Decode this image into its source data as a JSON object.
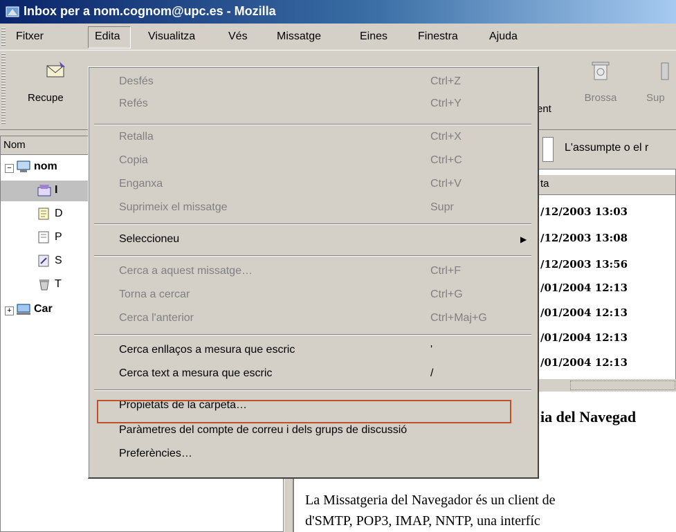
{
  "window": {
    "title": "Inbox per a nom.cognom@upc.es - Mozilla"
  },
  "menubar": {
    "items": [
      {
        "label": "Fitxer"
      },
      {
        "label": "Edita"
      },
      {
        "label": "Visualitza"
      },
      {
        "label": "Vés"
      },
      {
        "label": "Missatge"
      },
      {
        "label": "Eines"
      },
      {
        "label": "Finestra"
      },
      {
        "label": "Ajuda"
      }
    ]
  },
  "toolbar": {
    "recupera_label": "Recupe",
    "enviament_label": "ent",
    "brossa_label": "Brossa",
    "suprimeix_label": "Sup"
  },
  "folders": {
    "header": "Nom",
    "items": [
      {
        "label": "nom"
      },
      {
        "label": "I"
      },
      {
        "label": "D"
      },
      {
        "label": "P"
      },
      {
        "label": "S"
      },
      {
        "label": "T"
      },
      {
        "label": "Car"
      }
    ]
  },
  "search": {
    "label": "L'assumpte o el r"
  },
  "messages": {
    "date_header": "ta",
    "rows": [
      {
        "date": "/12/2003 13:03"
      },
      {
        "date": "/12/2003 13:08"
      },
      {
        "date": "/12/2003 13:56"
      },
      {
        "date": "/01/2004 12:13"
      },
      {
        "date": "/01/2004 12:13"
      },
      {
        "date": "/01/2004 12:13"
      },
      {
        "date": "/01/2004 12:13"
      }
    ]
  },
  "preview": {
    "heading": "ia del Navegad",
    "line1": "La Missatgeria del Navegador és un client de",
    "line2": "d'SMTP, POP3, IMAP, NNTP, una interfíc"
  },
  "edit_menu": {
    "items": [
      {
        "label": "Desfés",
        "shortcut": "Ctrl+Z",
        "enabled": false
      },
      {
        "label": "Refés",
        "shortcut": "Ctrl+Y",
        "enabled": false
      },
      {
        "label": "Retalla",
        "shortcut": "Ctrl+X",
        "enabled": false
      },
      {
        "label": "Copia",
        "shortcut": "Ctrl+C",
        "enabled": false
      },
      {
        "label": "Enganxa",
        "shortcut": "Ctrl+V",
        "enabled": false
      },
      {
        "label": "Suprimeix el missatge",
        "shortcut": "Supr",
        "enabled": false
      },
      {
        "label": "Seleccioneu",
        "shortcut": "",
        "enabled": true,
        "submenu_arrow": "▶"
      },
      {
        "label": "Cerca a aquest missatge…",
        "shortcut": "Ctrl+F",
        "enabled": false
      },
      {
        "label": "Torna a cercar",
        "shortcut": "Ctrl+G",
        "enabled": false
      },
      {
        "label": "Cerca l'anterior",
        "shortcut": "Ctrl+Maj+G",
        "enabled": false
      },
      {
        "label": "Cerca enllaços a mesura que escric",
        "shortcut": "'",
        "enabled": true
      },
      {
        "label": "Cerca text a mesura que escric",
        "shortcut": "/",
        "enabled": true
      },
      {
        "label": "Propietats de la carpeta…",
        "shortcut": "",
        "enabled": true
      },
      {
        "label": "Paràmetres del compte de correu i dels grups de discussió",
        "shortcut": "",
        "enabled": true,
        "highlighted": true
      },
      {
        "label": "Preferències…",
        "shortcut": "",
        "enabled": true
      }
    ]
  },
  "colors": {
    "highlight_border": "#c0502a",
    "titlebar_start": "#0a246a",
    "titlebar_end": "#a6caf0"
  }
}
